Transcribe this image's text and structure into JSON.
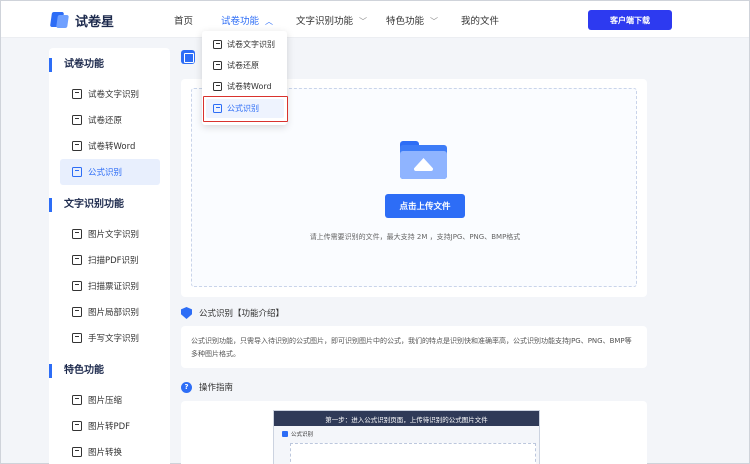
{
  "header": {
    "brand": "试卷星",
    "nav": [
      {
        "label": "首页",
        "has_chevron": false
      },
      {
        "label": "试卷功能",
        "has_chevron": true,
        "active": true
      },
      {
        "label": "文字识别功能",
        "has_chevron": true
      },
      {
        "label": "特色功能",
        "has_chevron": true
      },
      {
        "label": "我的文件",
        "has_chevron": false
      }
    ],
    "download_button": "客户端下载"
  },
  "dropdown": {
    "items": [
      {
        "label": "试卷文字识别",
        "icon": "document-text-icon"
      },
      {
        "label": "试卷还原",
        "icon": "document-restore-icon"
      },
      {
        "label": "试卷转Word",
        "icon": "word-convert-icon"
      },
      {
        "label": "公式识别",
        "icon": "formula-icon",
        "active": true
      }
    ]
  },
  "sidebar": {
    "sections": [
      {
        "title": "试卷功能",
        "items": [
          {
            "label": "试卷文字识别"
          },
          {
            "label": "试卷还原"
          },
          {
            "label": "试卷转Word"
          },
          {
            "label": "公式识别",
            "active": true
          }
        ]
      },
      {
        "title": "文字识别功能",
        "items": [
          {
            "label": "图片文字识别"
          },
          {
            "label": "扫描PDF识别"
          },
          {
            "label": "扫描票证识别"
          },
          {
            "label": "图片局部识别"
          },
          {
            "label": "手写文字识别"
          }
        ]
      },
      {
        "title": "特色功能",
        "items": [
          {
            "label": "图片压缩"
          },
          {
            "label": "图片转PDF"
          },
          {
            "label": "图片转换"
          }
        ]
      }
    ]
  },
  "upload": {
    "button": "点击上传文件",
    "hint": "请上传需要识别的文件，最大支持 2M ，支持JPG、PNG、BMP格式"
  },
  "intro": {
    "title": "公式识别【功能介绍】",
    "text": "公式识别功能，只需导入待识别的公式图片，即可识别图片中的公式，我们的特点是识别快和准确率高，公式识别功能支持JPG、PNG、BMP等多种图片格式。"
  },
  "guide": {
    "title": "操作指南",
    "step_banner": "第一步：进入公式识别页面，上传待识别的公式图片文件",
    "step_sub": "公式识别"
  },
  "colors": {
    "accent": "#2d6df6",
    "download_button": "#2d3af0",
    "highlight": "#d9322e"
  }
}
